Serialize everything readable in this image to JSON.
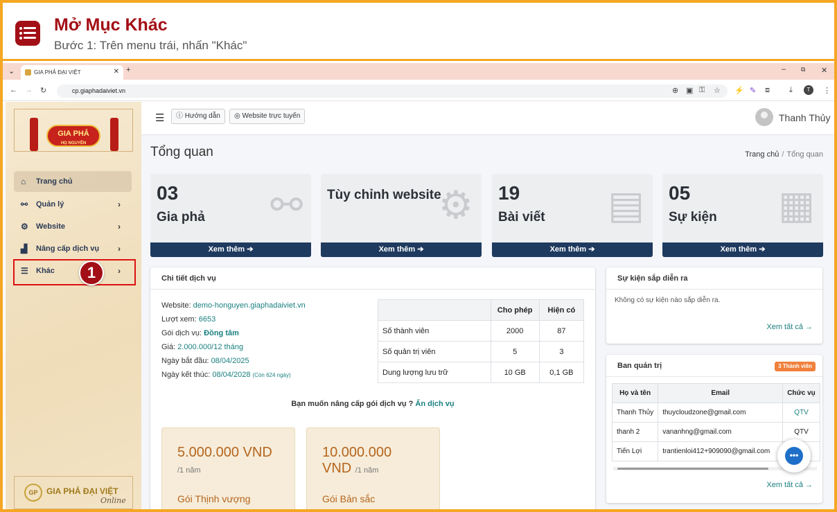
{
  "tutorial": {
    "title": "Mở Mục Khác",
    "subtitle": "Bước 1: Trên menu trái, nhấn \"Khác\"",
    "step_number": "1"
  },
  "browser": {
    "tab_title": "GIA PHẢ ĐẠI VIỆT",
    "url": "cp.giaphadaiviet.vn",
    "profile_initial": "T"
  },
  "sidebar": {
    "logo_text_top": "GIA PHẢ",
    "logo_text_sub": "HỌ NGUYỄN",
    "items": [
      {
        "label": "Trang chủ",
        "icon": "home-icon"
      },
      {
        "label": "Quản lý",
        "icon": "sitemap-icon"
      },
      {
        "label": "Website",
        "icon": "gear-icon"
      },
      {
        "label": "Nâng cấp dịch vụ",
        "icon": "chart-icon"
      },
      {
        "label": "Khác",
        "icon": "bars-icon"
      }
    ],
    "footer_logo_badge": "GP",
    "footer_logo_text": "GIA PHẢ ĐẠI VIỆT",
    "footer_logo_tag": "Online"
  },
  "topnav": {
    "guide_label": "Hướng dẫn",
    "website_label": "Website trực tuyến",
    "user_name": "Thanh Thủy"
  },
  "page": {
    "title": "Tổng quan",
    "breadcrumb": [
      "Trang chủ",
      "Tổng quan"
    ]
  },
  "stats": [
    {
      "number": "03",
      "label": "Gia phả",
      "footer": "Xem thêm"
    },
    {
      "number": "",
      "label": "Tùy chỉnh website",
      "footer": "Xem thêm"
    },
    {
      "number": "19",
      "label": "Bài viết",
      "footer": "Xem thêm"
    },
    {
      "number": "05",
      "label": "Sự kiện",
      "footer": "Xem thêm"
    }
  ],
  "service": {
    "header": "Chi tiết dịch vụ",
    "website_label": "Website:",
    "website_value": "demo-honguyen.giaphadaiviet.vn",
    "views_label": "Lượt xem:",
    "views_value": "6653",
    "package_label": "Gói dịch vụ:",
    "package_value": "Đồng tâm",
    "price_label": "Giá:",
    "price_value": "2.000.000/12 tháng",
    "start_label": "Ngày bắt đầu:",
    "start_value": "08/04/2025",
    "end_label": "Ngày kết thúc:",
    "end_value": "08/04/2028",
    "end_note": "(Còn 624 ngày)",
    "table_headers": [
      "",
      "Cho phép",
      "Hiện có"
    ],
    "table_rows": [
      [
        "Số thành viên",
        "2000",
        "87"
      ],
      [
        "Số quản trị viên",
        "5",
        "3"
      ],
      [
        "Dung lượng lưu trữ",
        "10 GB",
        "0,1 GB"
      ]
    ],
    "upgrade_text": "Bạn muốn nâng cấp gói dịch vụ ?",
    "upgrade_link": "Ấn dịch vụ",
    "plans": [
      {
        "price": "5.000.000 VND",
        "period": "/1 năm",
        "name": "Gói Thịnh vượng"
      },
      {
        "price": "10.000.000 VND",
        "period": "/1 năm",
        "name": "Gói Bản sắc"
      }
    ]
  },
  "events": {
    "header": "Sự kiện sắp diễn ra",
    "empty": "Không có sự kiện nào sắp diễn ra.",
    "see_all": "Xem tất cả"
  },
  "admins": {
    "header": "Ban quản trị",
    "badge": "3 Thành viên",
    "columns": [
      "Họ và tên",
      "Email",
      "Chức vụ"
    ],
    "rows": [
      [
        "Thanh Thủy",
        "thuycloudzone@gmail.com",
        "QTV"
      ],
      [
        "thanh 2",
        "vananhng@gmail.com",
        "QTV"
      ],
      [
        "Tiến Lợi",
        "trantienloi412+909090@gmail.com",
        ""
      ]
    ],
    "see_all": "Xem tất cả"
  },
  "colors": {
    "accent": "#a30f16",
    "frame": "#f5a623",
    "navy": "#1f3a5f",
    "link": "#1a7f7f"
  }
}
